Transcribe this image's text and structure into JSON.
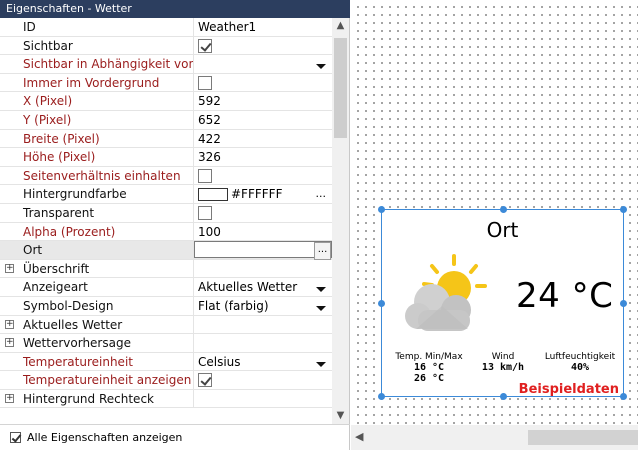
{
  "panel": {
    "title": "Eigenschaften - Wetter",
    "rows": [
      {
        "name": "ID",
        "value": "Weather1",
        "color": "black",
        "kind": "text"
      },
      {
        "name": "Sichtbar",
        "value": "",
        "color": "black",
        "kind": "checkbox",
        "checked": true
      },
      {
        "name": "Sichtbar in Abhängigkeit von",
        "value": "",
        "color": "red",
        "kind": "dropdown"
      },
      {
        "name": "Immer im Vordergrund",
        "value": "",
        "color": "red",
        "kind": "checkbox",
        "checked": false
      },
      {
        "name": "X (Pixel)",
        "value": "592",
        "color": "red",
        "kind": "text"
      },
      {
        "name": "Y (Pixel)",
        "value": "652",
        "color": "red",
        "kind": "text"
      },
      {
        "name": "Breite (Pixel)",
        "value": "422",
        "color": "red",
        "kind": "text"
      },
      {
        "name": "Höhe (Pixel)",
        "value": "326",
        "color": "red",
        "kind": "text"
      },
      {
        "name": "Seitenverhältnis einhalten",
        "value": "",
        "color": "red",
        "kind": "checkbox",
        "checked": false
      },
      {
        "name": "Hintergrundfarbe",
        "value": "#FFFFFF",
        "color": "black",
        "kind": "color",
        "swatch": "#ffffff"
      },
      {
        "name": "Transparent",
        "value": "",
        "color": "black",
        "kind": "checkbox",
        "checked": false
      },
      {
        "name": "Alpha (Prozent)",
        "value": "100",
        "color": "red",
        "kind": "text"
      },
      {
        "name": "Ort",
        "value": "",
        "color": "black",
        "kind": "field",
        "selected": true
      },
      {
        "name": "Überschrift",
        "value": "",
        "color": "black",
        "kind": "group"
      },
      {
        "name": "Anzeigeart",
        "value": "Aktuelles Wetter",
        "color": "black",
        "kind": "dropdown"
      },
      {
        "name": "Symbol-Design",
        "value": "Flat (farbig)",
        "color": "black",
        "kind": "dropdown"
      },
      {
        "name": "Aktuelles Wetter",
        "value": "",
        "color": "black",
        "kind": "group"
      },
      {
        "name": "Wettervorhersage",
        "value": "",
        "color": "black",
        "kind": "group"
      },
      {
        "name": "Temperatureinheit",
        "value": "Celsius",
        "color": "red",
        "kind": "dropdown"
      },
      {
        "name": "Temperatureinheit anzeigen",
        "value": "",
        "color": "red",
        "kind": "checkbox",
        "checked": true
      },
      {
        "name": "Hintergrund Rechteck",
        "value": "",
        "color": "black",
        "kind": "group"
      }
    ],
    "ellipsis": "...",
    "expander_glyph": "⊞",
    "footer_label": "Alle Eigenschaften anzeigen"
  },
  "widget": {
    "title": "Ort",
    "temperature": "24 °C",
    "icon": "sun-behind-cloud-icon",
    "stats": [
      {
        "label": "Temp. Min/Max",
        "values": [
          "16 °C",
          "26 °C"
        ]
      },
      {
        "label": "Wind",
        "values": [
          "13 km/h"
        ]
      },
      {
        "label": "Luftfeuchtigkeit",
        "values": [
          "40%"
        ]
      }
    ],
    "sample_label": "Beispieldaten"
  },
  "colors": {
    "panel_header": "#2c3e5f",
    "property_red": "#9a1c1c",
    "selection_blue": "#3c8ad8",
    "sample_red": "#e02020",
    "sun": "#f5c518",
    "cloud": "#c8c8c8"
  }
}
